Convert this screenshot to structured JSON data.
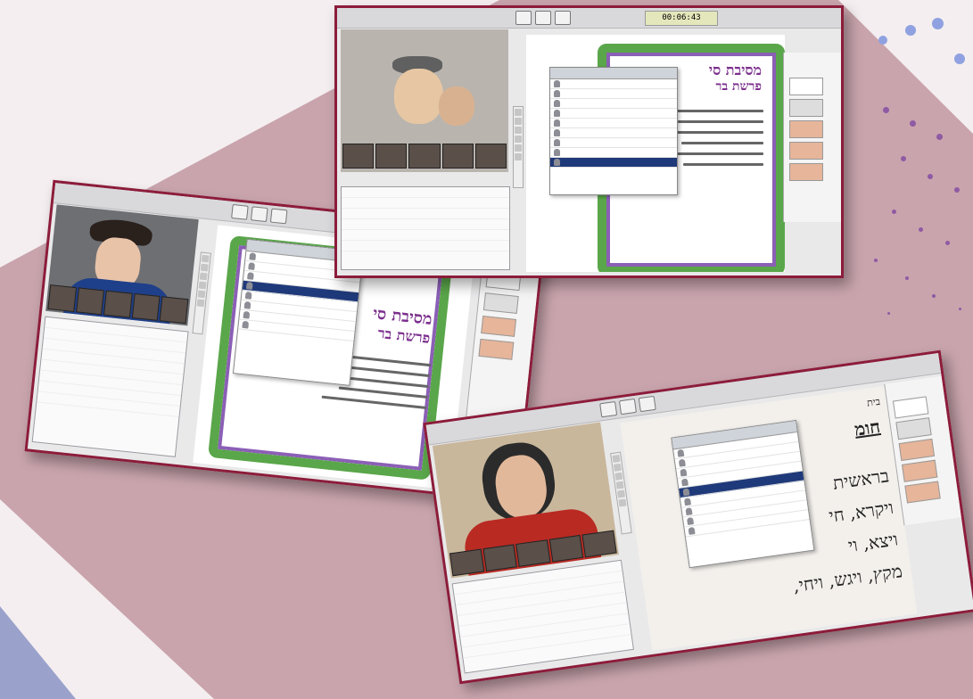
{
  "colors": {
    "background": "#c9a4ad",
    "frame": "#8c1c3a",
    "accent_navy": "#1f3a7a",
    "vine_green": "#5aa64a",
    "flower_purple": "#8b5fb6"
  },
  "session_timer": "00:06:43",
  "slide": {
    "title_line1": "מסיבת סי",
    "title_line2": "פרשת בר"
  },
  "document": {
    "heading": "חומ",
    "small_label": "בית",
    "line1": "בראשית",
    "line2": "ויקרא, חי",
    "line3": "ויצא, וי",
    "line4": "מקץ, ויגש, ויחי,"
  },
  "icons": [
    "camera-icon",
    "screen-share-icon",
    "whiteboard-icon",
    "pen-tool-icon",
    "text-tool-icon",
    "avatar-icon"
  ]
}
